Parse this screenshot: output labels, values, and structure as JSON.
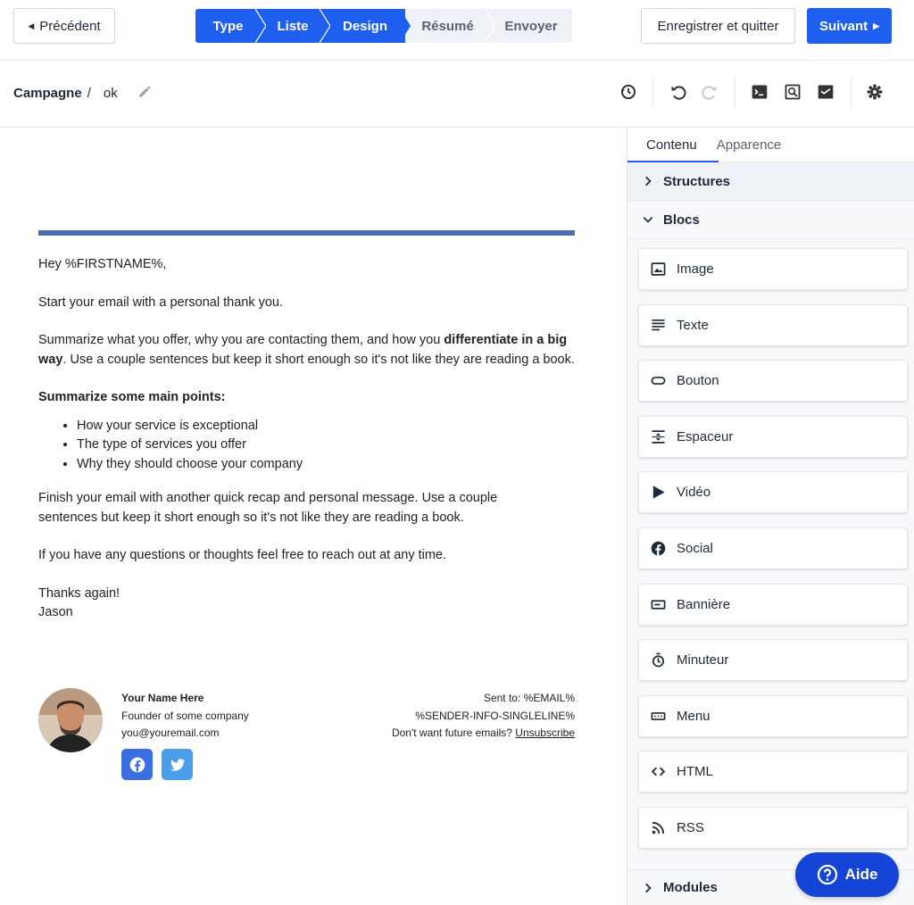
{
  "header": {
    "prev_label": "Précédent",
    "steps": [
      {
        "label": "Type",
        "state": "active"
      },
      {
        "label": "Liste",
        "state": "active"
      },
      {
        "label": "Design",
        "state": "active"
      },
      {
        "label": "Résumé",
        "state": "inactive"
      },
      {
        "label": "Envoyer",
        "state": "inactive"
      }
    ],
    "save_quit_label": "Enregistrer et quitter",
    "next_label": "Suivant"
  },
  "breadcrumb": {
    "section": "Campagne",
    "separator": "/",
    "name": "ok"
  },
  "toolbar": {
    "icons": [
      "history-icon",
      "undo-icon",
      "redo-icon",
      "code-icon",
      "preview-icon",
      "test-email-icon",
      "settings-icon"
    ]
  },
  "email": {
    "greeting": "Hey %FIRSTNAME%,",
    "intro": "Start your email with a personal thank you.",
    "summary_start": "Summarize what you offer, why you are contacting them, and how you ",
    "summary_bold": "differentiate in a big way",
    "summary_end": ". Use a couple sentences but keep it short enough so it's not like they are reading a book.",
    "points_title": "Summarize some main points:",
    "points": [
      "How your service is exceptional",
      "The type of services you offer",
      "Why they should choose your company"
    ],
    "finish": "Finish your email with another quick recap and personal message. Use a couple sentences but keep it short enough so it's not like they are reading a book.",
    "questions": "If you have any questions or thoughts feel free to reach out at any time.",
    "thanks": "Thanks again!",
    "signoff": "Jason"
  },
  "signature": {
    "name": "Your Name Here",
    "title": "Founder of some company",
    "email": "you@youremail.com",
    "sent_to": "Sent to: %EMAIL%",
    "sender_info": "%SENDER-INFO-SINGLELINE%",
    "unsubscribe_prefix": "Don't want future emails? ",
    "unsubscribe_link": "Unsubscribe",
    "social_colors": {
      "facebook": "#3b6fe0",
      "twitter": "#4a9ee8"
    }
  },
  "panel": {
    "tabs": [
      "Contenu",
      "Apparence"
    ],
    "structures_label": "Structures",
    "blocs_label": "Blocs",
    "blocks": [
      {
        "label": "Image",
        "icon": "image-icon"
      },
      {
        "label": "Texte",
        "icon": "text-icon"
      },
      {
        "label": "Bouton",
        "icon": "button-icon"
      },
      {
        "label": "Espaceur",
        "icon": "spacer-icon"
      },
      {
        "label": "Vidéo",
        "icon": "video-icon"
      },
      {
        "label": "Social",
        "icon": "facebook-icon"
      },
      {
        "label": "Bannière",
        "icon": "banner-icon"
      },
      {
        "label": "Minuteur",
        "icon": "timer-icon"
      },
      {
        "label": "Menu",
        "icon": "menu-icon"
      },
      {
        "label": "HTML",
        "icon": "code-icon"
      },
      {
        "label": "RSS",
        "icon": "rss-icon"
      }
    ],
    "modules_label": "Modules"
  },
  "help": {
    "label": "Aide"
  },
  "colors": {
    "accent": "#1e5ff0",
    "divider": "#4d6fad",
    "help": "#1545d6"
  }
}
